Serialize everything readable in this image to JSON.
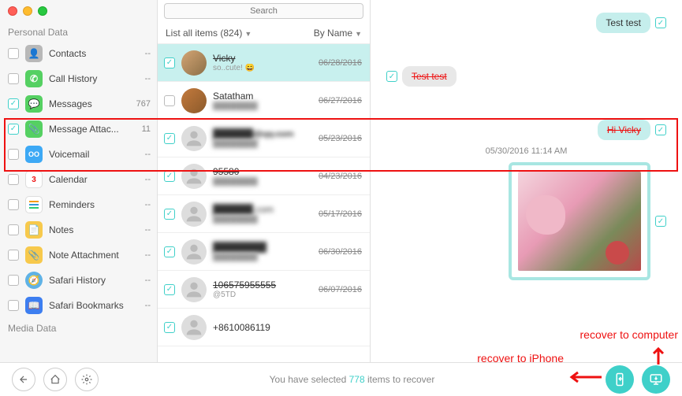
{
  "search": {
    "placeholder": "Search"
  },
  "sidebar": {
    "section1_title": "Personal Data",
    "section2_title": "Media Data",
    "items": [
      {
        "label": "Contacts",
        "count": "--"
      },
      {
        "label": "Call History",
        "count": "--"
      },
      {
        "label": "Messages",
        "count": "767"
      },
      {
        "label": "Message Attac...",
        "count": "11"
      },
      {
        "label": "Voicemail",
        "count": "--"
      },
      {
        "label": "Calendar",
        "count": "--"
      },
      {
        "label": "Reminders",
        "count": "--"
      },
      {
        "label": "Notes",
        "count": "--"
      },
      {
        "label": "Note Attachment",
        "count": "--"
      },
      {
        "label": "Safari History",
        "count": "--"
      },
      {
        "label": "Safari Bookmarks",
        "count": "--"
      }
    ]
  },
  "filters": {
    "left_label": "List all items (824)",
    "right_label": "By Name"
  },
  "conversations": [
    {
      "name": "Vicky",
      "sub": "so..cute! 😄",
      "date": "06/28/2016",
      "strike": true
    },
    {
      "name": "Satatham",
      "sub": "████████",
      "date": "06/27/2016",
      "strike": false
    },
    {
      "name": "██████@qq.com",
      "sub": "████████",
      "date": "05/23/2016",
      "strike": true
    },
    {
      "name": "95580",
      "sub": "████████",
      "date": "04/23/2016",
      "strike": true
    },
    {
      "name": "██████.com",
      "sub": "████████",
      "date": "05/17/2016",
      "strike": false
    },
    {
      "name": "████████",
      "sub": "████████",
      "date": "06/30/2016",
      "strike": false
    },
    {
      "name": "106575955555",
      "sub": "@5TD",
      "date": "06/07/2016",
      "strike": true
    },
    {
      "name": "+8610086119",
      "sub": "",
      "date": "",
      "strike": false
    }
  ],
  "chat": {
    "msg1": "Test test",
    "msg2": "Test test",
    "msg3": "Hi Vicky",
    "timestamp": "05/30/2016 11:14 AM"
  },
  "footer": {
    "status_prefix": "You have selected ",
    "status_count": "778",
    "status_suffix": " items to recover"
  },
  "annotations": {
    "to_iphone": "recover to iPhone",
    "to_computer": "recover to computer"
  },
  "icon_colors": {
    "contacts": "#b8b8b8",
    "callhistory": "#55d062",
    "messages": "#55d062",
    "msgattach": "#55d062",
    "voicemail": "#3da9f5",
    "calendar": "#fff",
    "reminders": "#fff",
    "notes": "#f7c94c",
    "noteattach": "#f7c94c",
    "safarihistory": "#5fb2e6",
    "safaribookmarks": "#3d7ef0"
  }
}
